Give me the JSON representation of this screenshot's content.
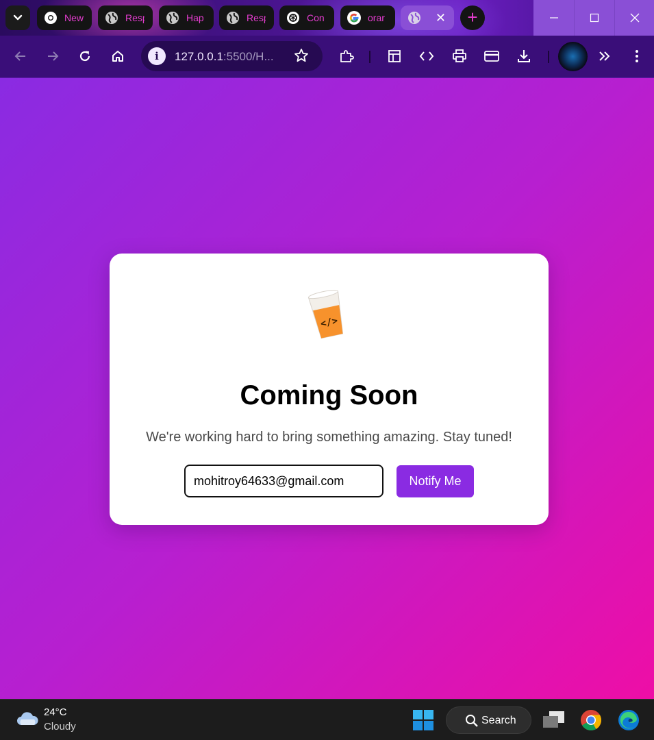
{
  "browser": {
    "tabs": [
      {
        "label": "New",
        "icon": "chrome-icon"
      },
      {
        "label": "Resp",
        "icon": "globe-icon"
      },
      {
        "label": "Hap",
        "icon": "globe-icon"
      },
      {
        "label": "Resp",
        "icon": "globe-icon"
      },
      {
        "label": "Con",
        "icon": "chatgpt-icon"
      },
      {
        "label": "orar",
        "icon": "google-icon"
      },
      {
        "label": "",
        "icon": "globe-icon",
        "active": true
      }
    ],
    "new_tab": "+",
    "address": {
      "host": "127.0.0.1",
      "rest": ":5500/H..."
    }
  },
  "page": {
    "title": "Coming Soon",
    "subtitle": "We're working hard to bring something amazing. Stay tuned!",
    "email_value": "mohitroy64633@gmail.com",
    "notify_label": "Notify Me",
    "logo_glyph": "</>"
  },
  "taskbar": {
    "temperature": "24°C",
    "condition": "Cloudy",
    "search_label": "Search"
  },
  "colors": {
    "accent": "#8a2be2",
    "bg_start": "#8a2be2",
    "bg_end": "#ee0ea6",
    "tab_text": "#e53dd0"
  }
}
